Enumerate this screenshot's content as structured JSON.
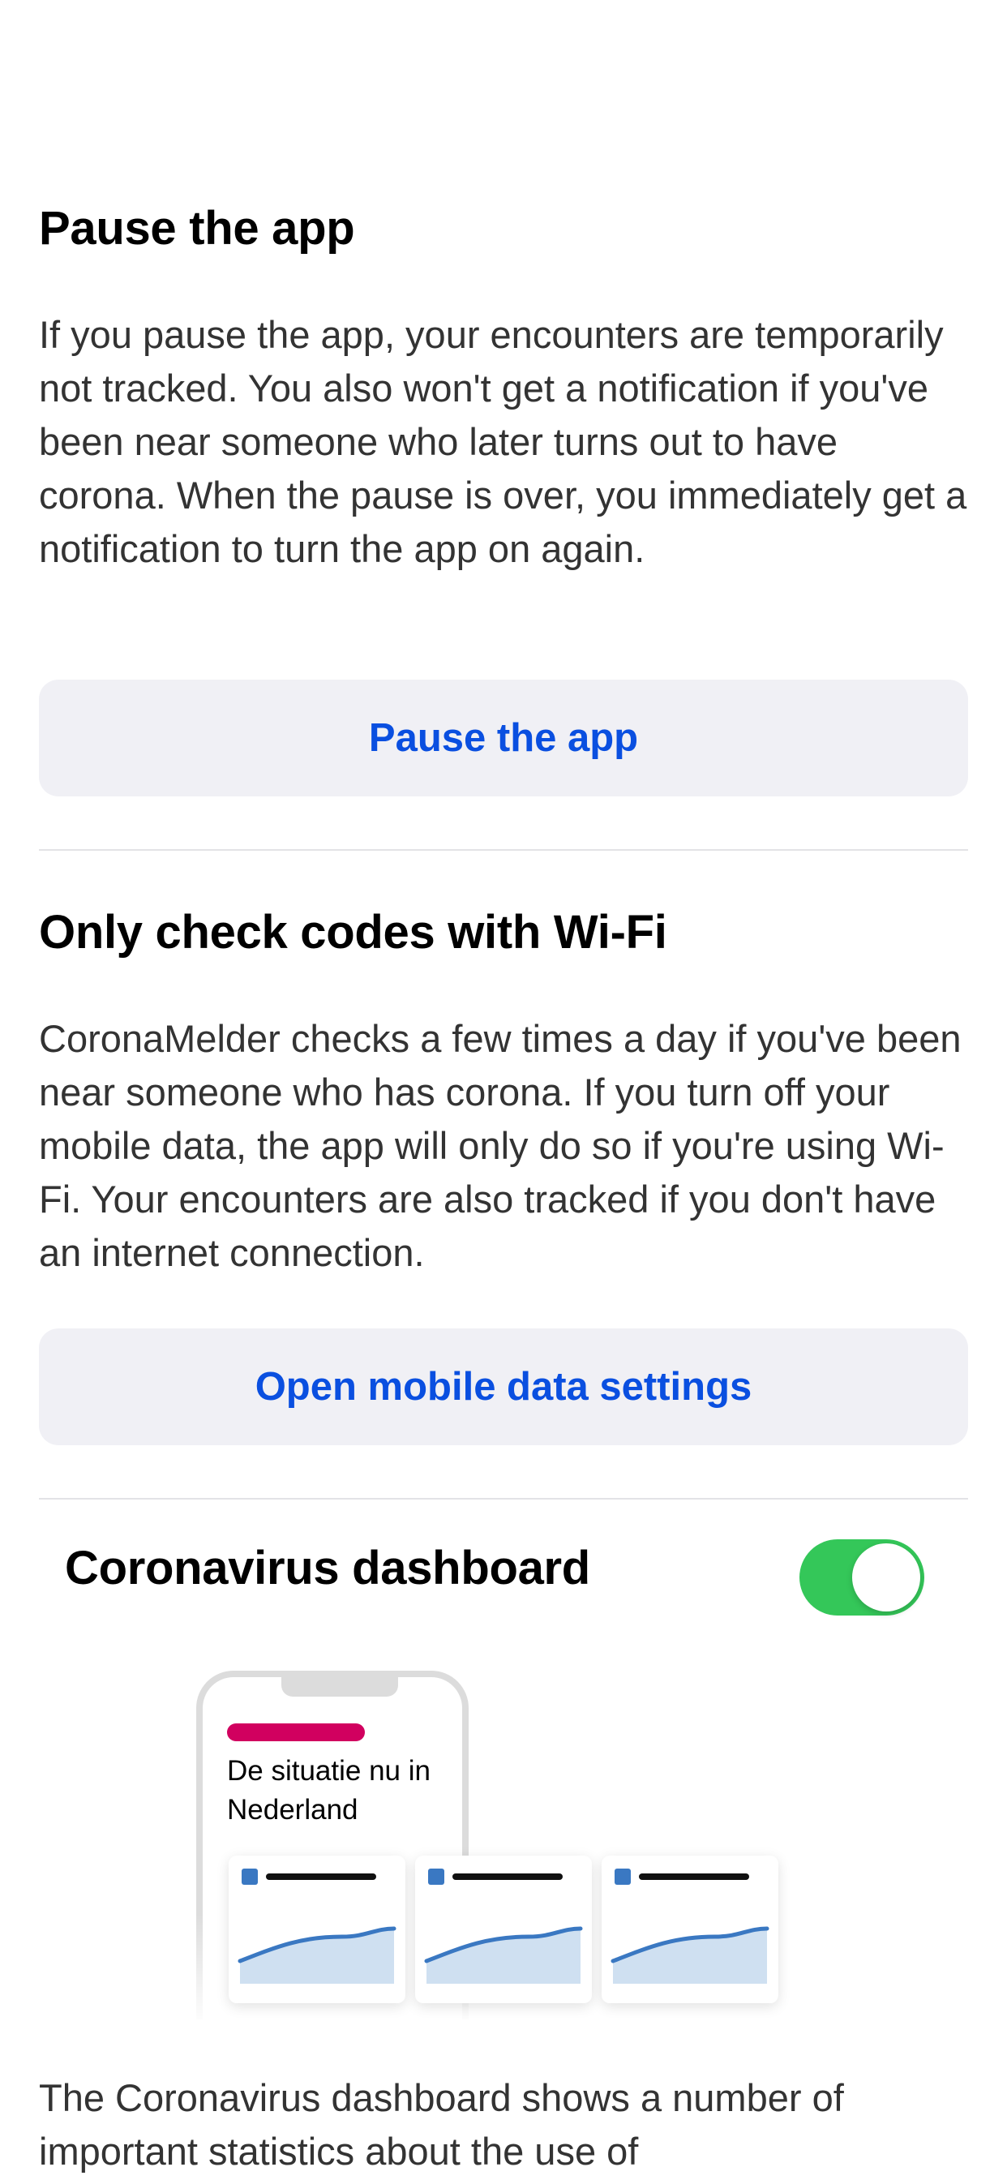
{
  "sections": {
    "pause": {
      "title": "Pause the app",
      "body": "If you pause the app, your encounters are temporarily not tracked. You also won't get a notification if you've been near someone who later turns out to have corona. When the pause is over, you immediately get a notification to turn the app on again.",
      "button": "Pause the app"
    },
    "wifi": {
      "title": "Only check codes with Wi-Fi",
      "body": "CoronaMelder checks a few times a day if you've been near someone who has corona. If you turn off your mobile data, the app will only do so if you're using Wi-Fi. Your encounters are also tracked if you don't have an internet connection.",
      "button": "Open mobile data settings"
    },
    "dashboard": {
      "title": "Coronavirus dashboard",
      "toggle_on": true,
      "illustration_text": "De situatie nu in Nederland",
      "body": "The Coronavirus dashboard shows a number of important statistics about the use of"
    }
  },
  "colors": {
    "link_blue": "#0a4fe0",
    "button_bg": "#f0f0f5",
    "toggle_green": "#34c759",
    "accent_pink": "#d1005f",
    "chart_blue": "#3a78c2"
  }
}
